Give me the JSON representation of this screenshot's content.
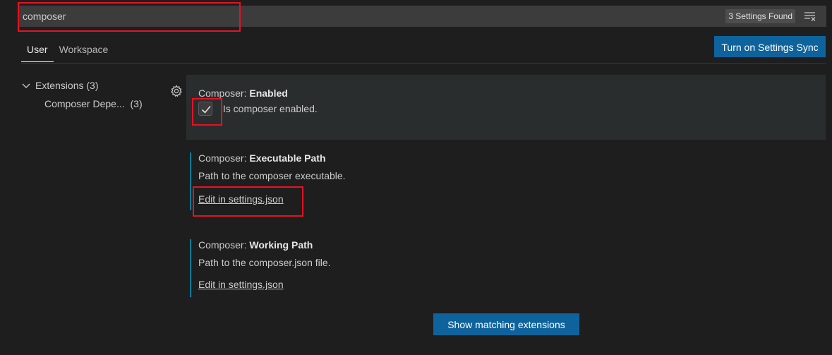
{
  "search": {
    "value": "composer",
    "found": "3 Settings Found",
    "clear_icon": "clear-filter-icon"
  },
  "tabs": [
    {
      "label": "User",
      "active": true
    },
    {
      "label": "Workspace",
      "active": false
    }
  ],
  "sync_button": "Turn on Settings Sync",
  "toc": {
    "extensions": {
      "label": "Extensions",
      "count": "(3)"
    },
    "composer_deps": {
      "label": "Composer Depe...",
      "count": "(3)"
    }
  },
  "settings": [
    {
      "category": "Composer: ",
      "name": "Enabled",
      "checkbox_label": "Is composer enabled.",
      "checked": true
    },
    {
      "category": "Composer: ",
      "name": "Executable Path",
      "description": "Path to the composer executable.",
      "link": "Edit in settings.json"
    },
    {
      "category": "Composer: ",
      "name": "Working Path",
      "description": "Path to the composer.json file.",
      "link": "Edit in settings.json"
    }
  ],
  "extensions_button": "Show matching extensions",
  "colors": {
    "accent_button": "#0e639c",
    "highlight": "#e81123",
    "modified_bar": "#0c7d9d"
  }
}
